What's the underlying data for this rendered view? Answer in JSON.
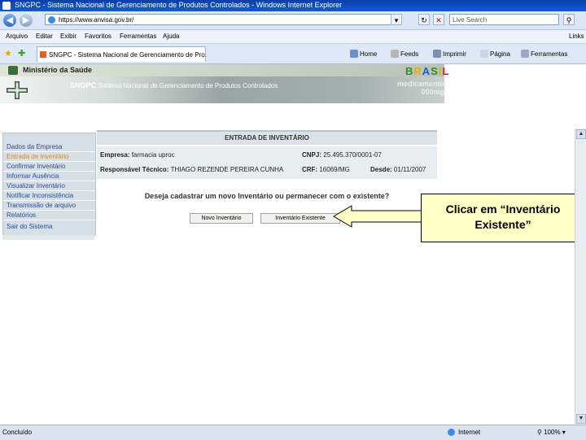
{
  "window": {
    "title": "SNGPC - Sistema Nacional de Gerenciamento de Produtos Controlados - Windows Internet Explorer"
  },
  "addressbar": {
    "url": "https://www.anvisa.gov.br/",
    "search_placeholder": "Live Search"
  },
  "menubar": [
    "Arquivo",
    "Editar",
    "Exibir",
    "Favoritos",
    "Ferramentas",
    "Ajuda",
    "Links"
  ],
  "tabbar": {
    "tab_title": "SNGPC - Sistema Nacional de Gerenciamento de Produ...",
    "tools": [
      "Home",
      "Feeds",
      "Imprimir",
      "Página",
      "Ferramentas"
    ]
  },
  "banner": {
    "ministry": "Ministério da Saúde",
    "brasil": [
      "B",
      "R",
      "A",
      "S",
      "I",
      "L"
    ],
    "system_short": "SNGPC",
    "system_full": "Sistema Nacional de Gerenciamento de Produtos Controlados",
    "medicamento": "medicamento",
    "dose": "000mg"
  },
  "leftmenu": [
    "Dados da Empresa",
    "Entrada de Inventário",
    "Confirmar Inventário",
    "Informar Ausência",
    "Visualizar Inventário",
    "Notificar Inconsistência",
    "Transmissão de arquivo",
    "Relatórios",
    "Sair do Sistema"
  ],
  "content": {
    "header": "ENTRADA DE INVENTÁRIO",
    "empresa_label": "Empresa:",
    "empresa_value": "farmacia uproc",
    "cnpj_label": "CNPJ:",
    "cnpj_value": "25.495.370/0001-07",
    "resp_label": "Responsável Técnico:",
    "resp_value": "THIAGO REZENDE PEREIRA CUNHA",
    "crf_label": "CRF:",
    "crf_value": "16069/MG",
    "desde_label": "Desde:",
    "desde_value": "01/11/2007",
    "question": "Deseja cadastrar um novo Inventário ou permanecer com o existente?",
    "btn_new": "Novo Inventário",
    "btn_existing": "Inventário Existente"
  },
  "callout": {
    "line1": "Clicar em “Inventário",
    "line2": "Existente”"
  },
  "statusbar": {
    "left": "Concluído",
    "zone": "Internet",
    "zoom": "100%"
  }
}
